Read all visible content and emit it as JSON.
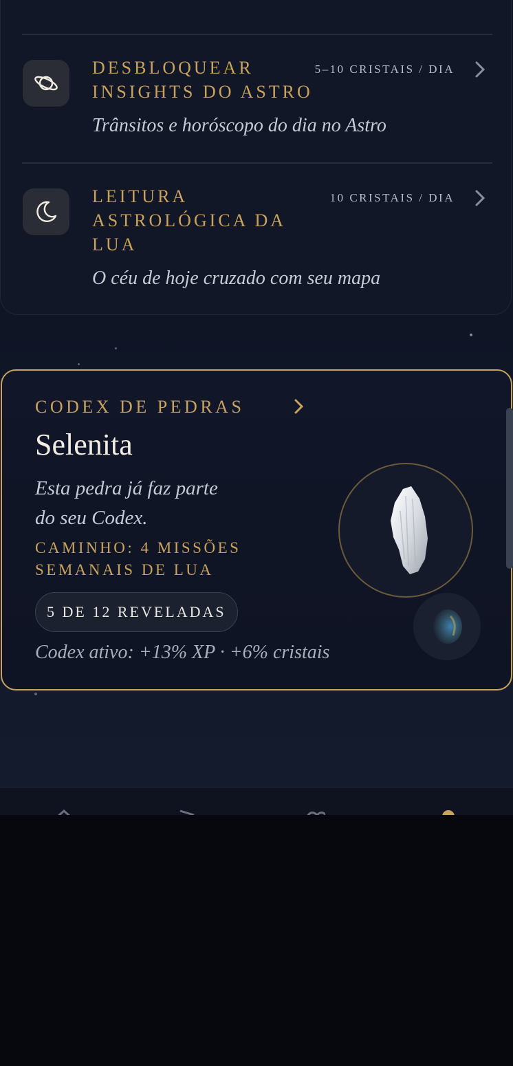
{
  "unlocks": [
    {
      "title": "DESBLOQUEAR INSIGHTS DO ASTRO",
      "title_lines": [
        "DESBLOQUEAR",
        "INSIGHTS DO ASTRO"
      ],
      "price": "5–10 CRISTAIS / DIA",
      "subtitle": "Trânsitos e horóscopo do dia no Astro",
      "icon": "planet-icon"
    },
    {
      "title": "LEITURA ASTROLÓGICA DA LUA",
      "title_lines": [
        "LEITURA",
        "ASTROLÓGICA DA",
        "LUA"
      ],
      "price": "10 CRISTAIS / DIA",
      "subtitle": "O céu de hoje cruzado com seu mapa",
      "icon": "moon-icon"
    }
  ],
  "codex": {
    "label": "CODEX DE PEDRAS",
    "stone_name": "Selenita",
    "description_lines": [
      "Esta pedra já faz parte",
      "do seu Codex."
    ],
    "path_lines": [
      "CAMINHO: 4 MISSÕES",
      "SEMANAIS DE LUA"
    ],
    "revealed": "5 DE 12 REVELADAS",
    "revealed_count": 5,
    "total_count": 12,
    "bonus": "Codex ativo: +13% XP · +6% cristais",
    "stone_icon": "selenite-crystal-icon",
    "secondary_stone_icon": "labradorite-stone-icon"
  },
  "colors": {
    "gold": "#c9a25e",
    "background": "#0f1525",
    "text_muted": "#c7cbd6"
  },
  "nav_icons": [
    "home-icon",
    "flag-icon",
    "heart-icon",
    "profile-icon"
  ]
}
